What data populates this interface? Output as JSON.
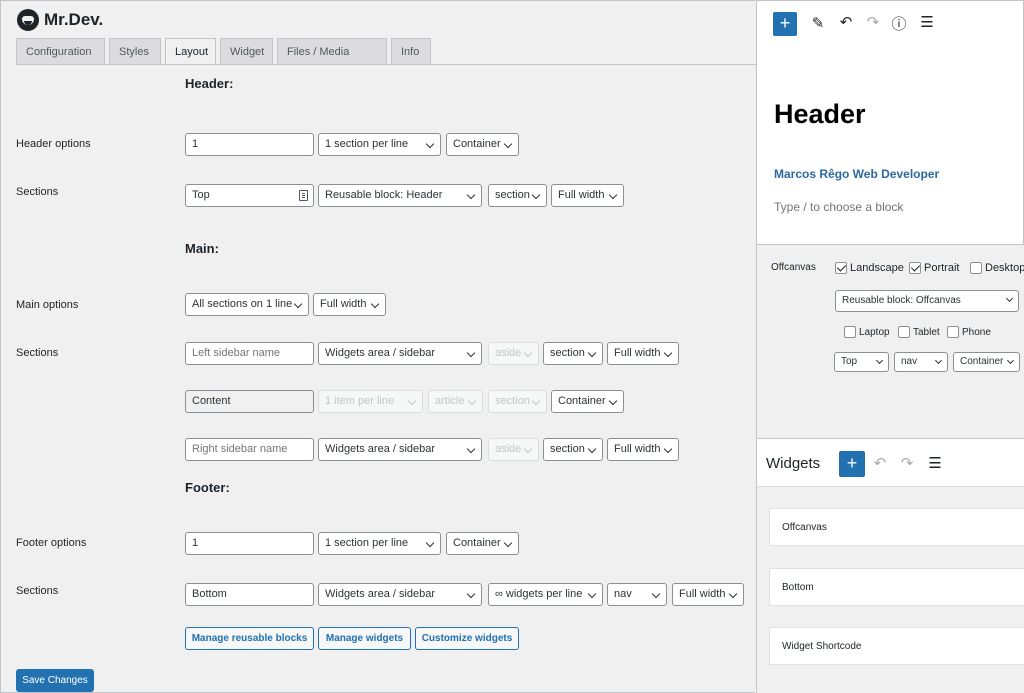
{
  "brand": {
    "name": "Mr.Dev."
  },
  "tabs": [
    "Configuration",
    "Styles",
    "Layout",
    "Widget",
    "Files / Media",
    "Info"
  ],
  "header": {
    "title": "Header:",
    "options_label": "Header options",
    "options_value": "1",
    "options_per_line": "1 section per line",
    "options_container": "Container",
    "sections_label": "Sections",
    "section_name": "Top",
    "section_block": "Reusable block: Header",
    "section_tag": "section",
    "section_width": "Full width"
  },
  "main": {
    "title": "Main:",
    "options_label": "Main options",
    "options_layout": "All sections on 1 line",
    "options_width": "Full width",
    "sections_label": "Sections",
    "left_placeholder": "Left sidebar name",
    "left_type": "Widgets area / sidebar",
    "left_aside": "aside",
    "left_tag": "section",
    "left_width": "Full width",
    "content_value": "Content",
    "content_per_line": "1 item per line",
    "content_article": "article",
    "content_section": "section",
    "content_container": "Container",
    "right_placeholder": "Right sidebar name",
    "right_type": "Widgets area / sidebar",
    "right_aside": "aside",
    "right_tag": "section",
    "right_width": "Full width"
  },
  "footer": {
    "title": "Footer:",
    "options_label": "Footer options",
    "options_value": "1",
    "options_per_line": "1 section per line",
    "options_container": "Container",
    "sections_label": "Sections",
    "section_name": "Bottom",
    "section_type": "Widgets area / sidebar",
    "section_widgets": "∞ widgets per line",
    "section_tag": "nav",
    "section_width": "Full width"
  },
  "buttons": {
    "manage_reusable": "Manage reusable blocks",
    "manage_widgets": "Manage widgets",
    "customize_widgets": "Customize widgets",
    "save": "Save Changes"
  },
  "editor": {
    "heading": "Header",
    "link": "Marcos Rêgo Web Developer",
    "placeholder": "Type / to choose a block"
  },
  "offcanvas": {
    "label": "Offcanvas",
    "landscape": "Landscape",
    "portrait": "Portrait",
    "desktop": "Desktop",
    "block": "Reusable block: Offcanvas",
    "laptop": "Laptop",
    "tablet": "Tablet",
    "phone": "Phone",
    "position": "Top",
    "tag": "nav",
    "container": "Container"
  },
  "widgets": {
    "title": "Widgets",
    "items": [
      "Offcanvas",
      "Bottom",
      "Widget Shortcode"
    ]
  },
  "colors": {
    "accent": "#2271b1",
    "background": "#f0f0f1"
  }
}
